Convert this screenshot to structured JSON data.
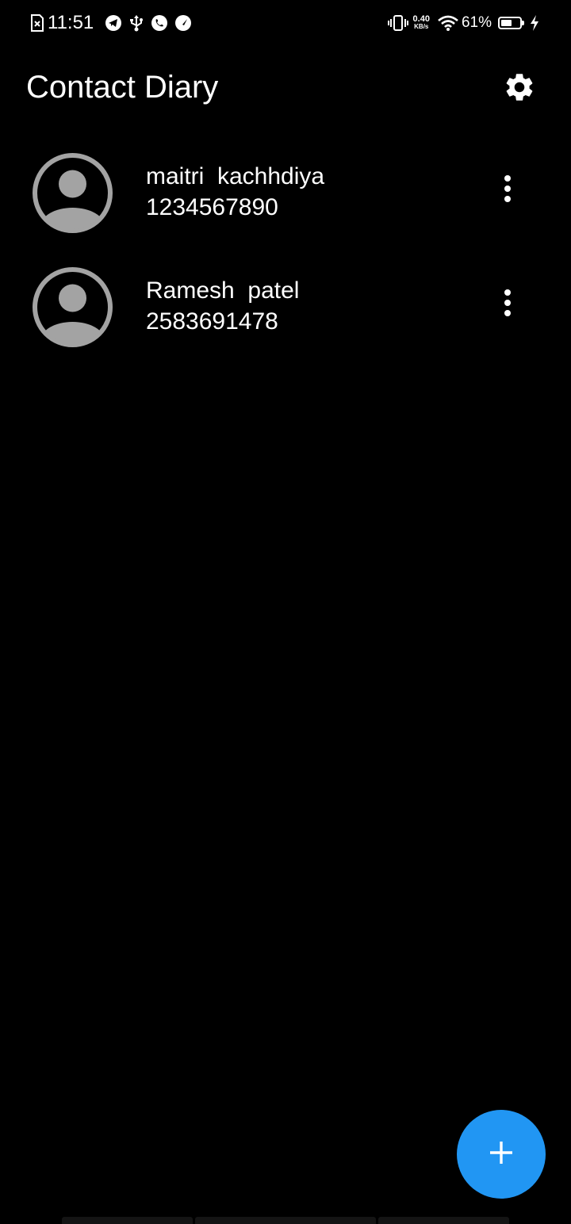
{
  "status_bar": {
    "time": "11:51",
    "left_icons": [
      "sim-error-icon",
      "telegram-icon",
      "usb-icon",
      "whatsapp-icon",
      "speedometer-icon"
    ],
    "net_speed_value": "0.40",
    "net_speed_unit": "KB/s",
    "battery_percent": "61%",
    "battery_level": 0.61,
    "right_icons": [
      "vibrate-icon",
      "wifi-icon",
      "battery-icon",
      "charging-icon"
    ]
  },
  "app_bar": {
    "title": "Contact Diary",
    "settings_icon": "gear-icon"
  },
  "contacts": [
    {
      "name": "maitri  kachhdiya",
      "phone": "1234567890",
      "avatar_icon": "person-avatar-icon",
      "menu_icon": "more-vertical-icon"
    },
    {
      "name": "Ramesh  patel",
      "phone": "2583691478",
      "avatar_icon": "person-avatar-icon",
      "menu_icon": "more-vertical-icon"
    }
  ],
  "fab": {
    "icon": "plus-icon"
  },
  "colors": {
    "background": "#000000",
    "text": "#ffffff",
    "avatar": "#a3a3a3",
    "fab": "#2196f3"
  }
}
